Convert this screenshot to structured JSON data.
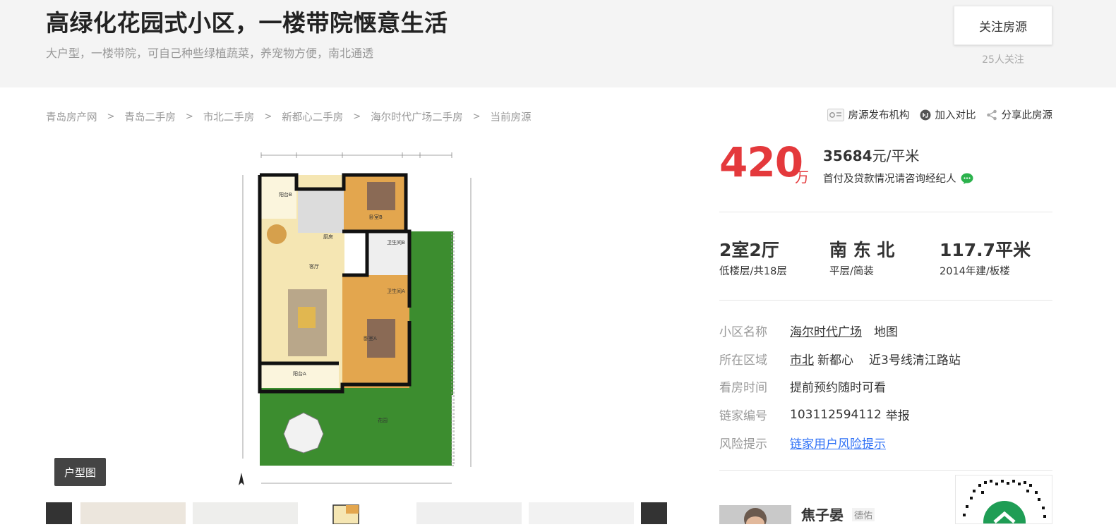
{
  "header": {
    "title": "高绿化花园式小区，一楼带院惬意生活",
    "subtitle": "大户型，一楼带院，可自己种些绿植蔬菜，养宠物方便，南北通透",
    "follow_button": "关注房源",
    "follow_count": "25人关注"
  },
  "breadcrumb": [
    "青岛房产网",
    "青岛二手房",
    "市北二手房",
    "新都心二手房",
    "海尔时代广场二手房",
    "当前房源"
  ],
  "breadcrumb_separator": ">",
  "tools": {
    "publisher": "房源发布机构",
    "compare": "加入对比",
    "share": "分享此房源"
  },
  "gallery": {
    "tag": "户型图"
  },
  "price": {
    "total": "420",
    "unit": "万",
    "per_sqm_value": "35684",
    "per_sqm_unit": "元/平米",
    "loan_tip": "首付及贷款情况请咨询经纪人"
  },
  "specs": [
    {
      "main": "2室2厅",
      "sub": "低楼层/共18层"
    },
    {
      "main": "南 东 北",
      "sub": "平层/简装"
    },
    {
      "main": "117.7平米",
      "sub": "2014年建/板楼"
    }
  ],
  "info": {
    "community_label": "小区名称",
    "community_name": "海尔时代广场",
    "community_map": "地图",
    "area_label": "所在区域",
    "area_district": "市北",
    "area_sub": "新都心",
    "area_metro": "近3号线清江路站",
    "visit_label": "看房时间",
    "visit_value": "提前预约随时可看",
    "id_label": "链家编号",
    "id_value": "103112594112",
    "id_report": "举报",
    "risk_label": "风险提示",
    "risk_link": "链家用户风险提示"
  },
  "agent": {
    "name": "焦子晏",
    "brand": "德佑"
  },
  "colors": {
    "price_red": "#e4393c",
    "link_blue": "#3072f6",
    "wechat_green": "#2bb24c"
  }
}
